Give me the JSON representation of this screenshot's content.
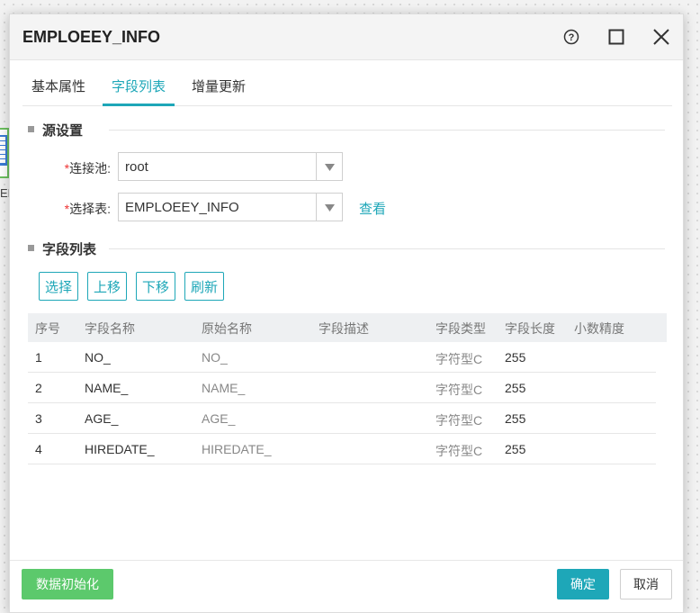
{
  "background": {
    "node_label": "EE"
  },
  "dialog": {
    "title": "EMPLOEEY_INFO"
  },
  "tabs": [
    {
      "label": "基本属性",
      "active": false
    },
    {
      "label": "字段列表",
      "active": true
    },
    {
      "label": "增量更新",
      "active": false
    }
  ],
  "source_settings": {
    "title": "源设置",
    "connection_pool": {
      "required_mark": "*",
      "label": "连接池:",
      "value": "root"
    },
    "select_table": {
      "required_mark": "*",
      "label": "选择表:",
      "value": "EMPLOEEY_INFO"
    },
    "view_link": "查看"
  },
  "field_list": {
    "title": "字段列表",
    "buttons": {
      "select": "选择",
      "move_up": "上移",
      "move_down": "下移",
      "refresh": "刷新"
    },
    "columns": [
      "序号",
      "字段名称",
      "原始名称",
      "字段描述",
      "字段类型",
      "字段长度",
      "小数精度"
    ],
    "rows": [
      {
        "index": "1",
        "name": "NO_",
        "original": "NO_",
        "desc": "",
        "type": "字符型C",
        "length": "255",
        "precision": ""
      },
      {
        "index": "2",
        "name": "NAME_",
        "original": "NAME_",
        "desc": "",
        "type": "字符型C",
        "length": "255",
        "precision": ""
      },
      {
        "index": "3",
        "name": "AGE_",
        "original": "AGE_",
        "desc": "",
        "type": "字符型C",
        "length": "255",
        "precision": ""
      },
      {
        "index": "4",
        "name": "HIREDATE_",
        "original": "HIREDATE_",
        "desc": "",
        "type": "字符型C",
        "length": "255",
        "precision": ""
      }
    ]
  },
  "footer": {
    "init_button": "数据初始化",
    "ok_button": "确定",
    "cancel_button": "取消"
  },
  "colors": {
    "accent": "#1ea7b8",
    "init_green": "#5cc96c",
    "required": "#e33333"
  },
  "icons": [
    "help-icon",
    "maximize-icon",
    "close-icon",
    "dropdown-arrow-icon"
  ]
}
